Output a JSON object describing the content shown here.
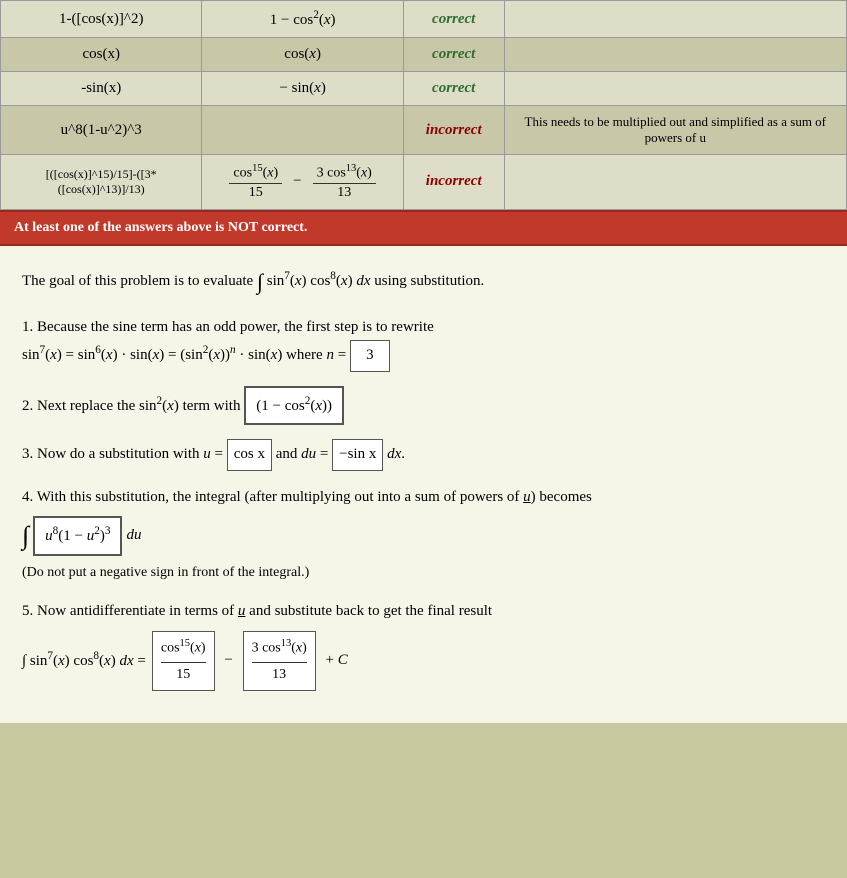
{
  "table": {
    "rows": [
      {
        "input": "1-([cos(x)]^2)",
        "answer_math": "1 − cos²(x)",
        "status": "correct",
        "feedback": ""
      },
      {
        "input": "cos(x)",
        "answer_math": "cos(x)",
        "status": "correct",
        "feedback": ""
      },
      {
        "input": "-sin(x)",
        "answer_math": "− sin(x)",
        "status": "correct",
        "feedback": ""
      },
      {
        "input": "u^8(1-u^2)^3",
        "answer_math": "",
        "status": "incorrect",
        "feedback": "This needs to be multiplied out and simplified as a sum of powers of u"
      },
      {
        "input": "[([cos(x)]^15)/15]-([3*([cos(x)]^13)]/13)",
        "answer_math_frac": true,
        "status": "incorrect",
        "feedback": ""
      }
    ]
  },
  "alert": "At least one of the answers above is NOT correct.",
  "goal_text": "The goal of this problem is to evaluate",
  "goal_integral": "∫ sin⁷(x) cos⁸(x) dx using substitution.",
  "steps": [
    {
      "number": "1.",
      "text_before": "Because the sine term has an odd power, the first step is to rewrite",
      "equation": "sin⁷(x) = sin⁶(x) · sin(x) = (sin²(x))ⁿ · sin(x) where n =",
      "box_value": "3"
    },
    {
      "number": "2.",
      "text": "Next replace the sin²(x) term with",
      "box_value": "(1 − cos²(x))"
    },
    {
      "number": "3.",
      "text_before": "Now do a substitution with u =",
      "u_box": "cos x",
      "text_mid": "and du =",
      "du_box": "−sin x",
      "text_after": "dx."
    },
    {
      "number": "4.",
      "text": "With this substitution, the integral (after multiplying out into a sum of powers of u) becomes",
      "integral_box": "u⁸(1 − u²)³",
      "text_after": "du",
      "note": "(Do not put a negative sign in front of the integral.)"
    },
    {
      "number": "5.",
      "text": "Now antidifferentiate in terms of u and substitute back to get the final result",
      "result_prefix": "∫ sin⁷(x) cos⁸(x) dx =",
      "result_box1_numer": "cos¹⁵(x)",
      "result_box1_denom": "15",
      "result_minus": "−",
      "result_box2_numer": "3 cos¹³(x)",
      "result_box2_denom": "13",
      "result_suffix": "+ C"
    }
  ]
}
